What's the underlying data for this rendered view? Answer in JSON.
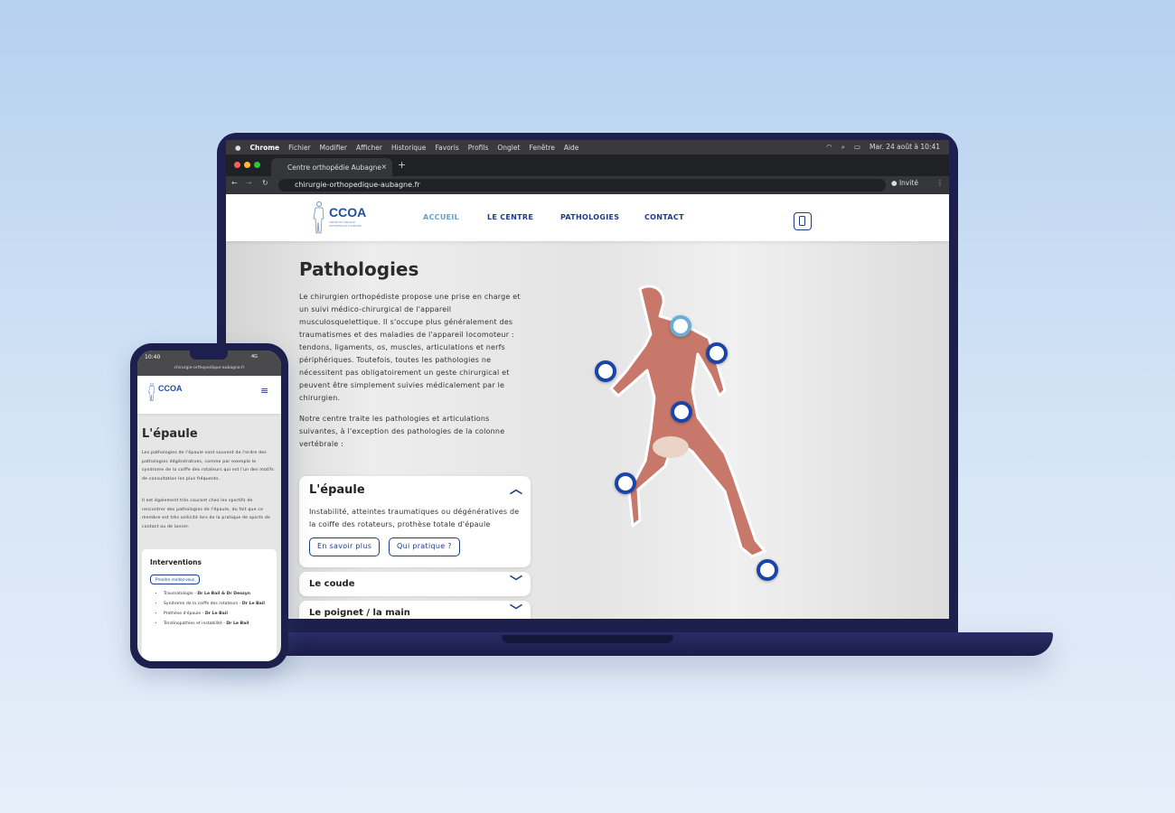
{
  "macos_menubar": {
    "apple": "",
    "app": "Chrome",
    "items": [
      "Fichier",
      "Modifier",
      "Afficher",
      "Historique",
      "Favoris",
      "Profils",
      "Onglet",
      "Fenêtre",
      "Aide"
    ],
    "datetime": "Mar. 24 août à  10:41"
  },
  "browser": {
    "tab_title": "Centre orthopédie Aubagne",
    "tab_close": "×",
    "new_tab": "+",
    "url": "chirurgie-orthopedique-aubagne.fr",
    "profile": "Invité",
    "back": "←",
    "forward": "→",
    "reload": "↻",
    "menu": "⋮"
  },
  "site": {
    "logo": {
      "name": "CCOA",
      "tagline": "CENTRE DE CHIRURGIE ORTHOPÉDIQUE D'AUBAGNE"
    },
    "nav": [
      {
        "label": "ACCUEIL",
        "active": true
      },
      {
        "label": "LE CENTRE"
      },
      {
        "label": "PATHOLOGIES"
      },
      {
        "label": "CONTACT"
      }
    ],
    "title": "Pathologies",
    "intro": "Le chirurgien orthopédiste propose une prise en charge et un suivi médico-chirurgical de l'appareil musculosquelettique. Il s'occupe plus généralement des traumatismes et des maladies de l'appareil locomoteur : tendons, ligaments, os, muscles, articulations et nerfs périphériques. Toutefois, toutes les pathologies ne nécessitent pas obligatoirement un geste chirurgical et peuvent être simplement suivies médicalement par le chirurgien.",
    "intro2": "Notre centre traite les pathologies et articulations suivantes, à l'exception des pathologies de la colonne vertébrale :",
    "accordion": [
      {
        "title": "L'épaule",
        "expanded": true,
        "description": "Instabilité, atteintes traumatiques ou dégénératives de la coiffe des rotateurs, prothèse totale d'épaule",
        "buttons": [
          "En savoir plus",
          "Qui pratique ?"
        ]
      },
      {
        "title": "Le coude",
        "expanded": false
      },
      {
        "title": "Le poignet / la main",
        "expanded": false
      }
    ],
    "colors": {
      "primary": "#1c3d8a",
      "active_nav": "#6aa0c8",
      "marker": "#1a44a8",
      "marker_active": "#6aaed8"
    }
  },
  "phone": {
    "time": "10:40",
    "signal": "4G",
    "url": "chirurgie-orthopedique-aubagne.fr",
    "menu_icon": "hamburger-icon",
    "title": "L'épaule",
    "p1": "Les pathologies de l'épaule sont souvent de l'ordre des pathologies dégénératives, comme par exemple le syndrome de la coiffe des rotateurs qui est l'un des motifs de consultation les plus fréquents.",
    "p2": "Il est également très courant chez les sportifs de rencontrer des pathologies de l'épaule, du fait que ce membre est très sollicité lors de la pratique de sports de contact ou de lancer.",
    "card_title": "Interventions",
    "cta": "Prendre rendez-vous",
    "list": [
      {
        "name": "Traumatologie",
        "doctor": "Dr Le Bail & Dr Dessyn"
      },
      {
        "name": "Syndrome de la coiffe des rotateurs",
        "doctor": "Dr Le Bail"
      },
      {
        "name": "Prothèse d'épaule",
        "doctor": "Dr Le Bail"
      },
      {
        "name": "Tendinopathies et instabilité",
        "doctor": "Dr Le Bail"
      }
    ]
  }
}
